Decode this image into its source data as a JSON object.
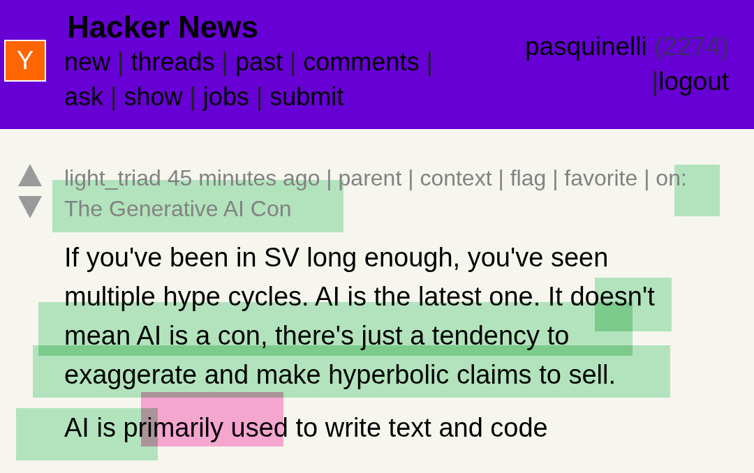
{
  "header": {
    "logo": "Y",
    "title": "Hacker News",
    "separator": "|",
    "nav": [
      "new",
      "threads",
      "past",
      "comments",
      "ask",
      "show",
      "jobs",
      "submit"
    ],
    "user": "pasquinelli",
    "karma": "(2274)",
    "logout": "logout"
  },
  "comment": {
    "user": "light_triad",
    "age": "45 minutes ago",
    "separator": "|",
    "links": [
      "parent",
      "context",
      "flag",
      "favorite"
    ],
    "on_label": "on:",
    "story": "The Generative AI Con",
    "paragraphs": [
      "If you've been in SV long enough, you've seen multiple hype cycles. AI is the latest one. It doesn't mean AI is a con, there's just a tendency to exaggerate and make hyperbolic claims to sell.",
      "AI is primarily used to write text and code"
    ]
  },
  "highlights": [
    {
      "color": "#b2e3bd"
    },
    {
      "color": "#b2e3bd"
    },
    {
      "color": "#b2e3bd"
    },
    {
      "color": "#b2e3bd"
    },
    {
      "color": "#b2e3bd"
    },
    {
      "color": "#b2e3bd"
    },
    {
      "color": "#f5a6cf"
    }
  ]
}
